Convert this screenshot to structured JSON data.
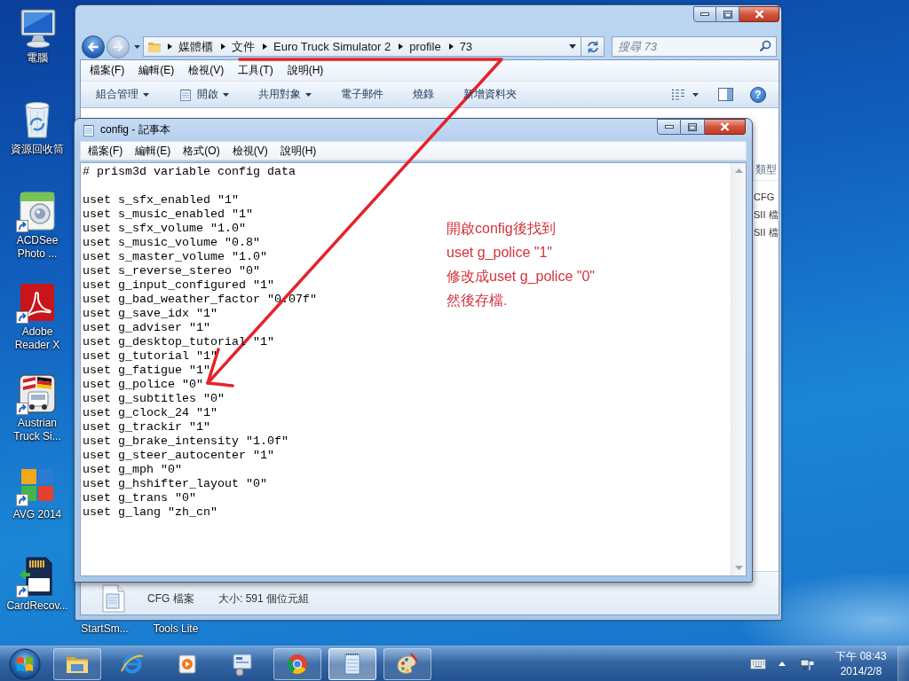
{
  "desktop_icons": [
    {
      "label": "電腦",
      "kind": "computer",
      "shortcut": false
    },
    {
      "label": "資源回收筒",
      "kind": "trash",
      "shortcut": false
    },
    {
      "label": "ACDSee Photo ...",
      "kind": "camera",
      "shortcut": true
    },
    {
      "label": "Adobe Reader X",
      "kind": "pdf",
      "shortcut": true
    },
    {
      "label": "Austrian Truck Si...",
      "kind": "truck",
      "shortcut": true
    },
    {
      "label": "AVG 2014",
      "kind": "grid",
      "shortcut": true
    },
    {
      "label": "CardRecov...",
      "kind": "card",
      "shortcut": true
    }
  ],
  "covered_desktop_labels": [
    "StartSm...",
    "Tools Lite"
  ],
  "explorer": {
    "history": [
      {
        "kind": "back",
        "disabled": false
      },
      {
        "kind": "forward",
        "disabled": true
      }
    ],
    "crumbs": [
      "媒體櫃",
      "文件",
      "Euro Truck Simulator 2",
      "profile",
      "73"
    ],
    "search": {
      "placeholder": "搜尋 73"
    },
    "menu": [
      "檔案(F)",
      "編輯(E)",
      "檢視(V)",
      "工具(T)",
      "說明(H)"
    ],
    "toolbar": [
      {
        "label": "組合管理",
        "dropdown": true,
        "icon": false
      },
      {
        "label": "開啟",
        "dropdown": true,
        "icon": true
      },
      {
        "label": "共用對象",
        "dropdown": true,
        "icon": false
      },
      {
        "label": "電子郵件",
        "dropdown": false,
        "icon": false
      },
      {
        "label": "燒錄",
        "dropdown": false,
        "icon": false
      },
      {
        "label": "新增資料夾",
        "dropdown": false,
        "icon": false
      }
    ],
    "help_button": "?",
    "file_list": {
      "column_heading": "類型",
      "rows": [
        "CFG",
        "SII 檔",
        "SII 檔"
      ]
    },
    "details": {
      "type": "CFG 檔案",
      "size": "大小: 591 個位元組"
    }
  },
  "notepad": {
    "title": "config - 記事本",
    "menu": [
      "檔案(F)",
      "編輯(E)",
      "格式(O)",
      "檢視(V)",
      "說明(H)"
    ],
    "header_line": "# prism3d variable config data",
    "lines": [
      "uset s_sfx_enabled \"1\"",
      "uset s_music_enabled \"1\"",
      "uset s_sfx_volume \"1.0\"",
      "uset s_music_volume \"0.8\"",
      "uset s_master_volume \"1.0\"",
      "uset s_reverse_stereo \"0\"",
      "uset g_input_configured \"1\"",
      "uset g_bad_weather_factor \"0.07f\"",
      "uset g_save_idx \"1\"",
      "uset g_adviser \"1\"",
      "uset g_desktop_tutorial \"1\"",
      "uset g_tutorial \"1\"",
      "uset g_fatigue \"1\"",
      "uset g_police \"0\"",
      "uset g_subtitles \"0\"",
      "uset g_clock_24 \"1\"",
      "uset g_trackir \"1\"",
      "uset g_brake_intensity \"1.0f\"",
      "uset g_steer_autocenter \"1\"",
      "uset g_mph \"0\"",
      "uset g_hshifter_layout \"0\"",
      "uset g_trans \"0\"",
      "uset g_lang \"zh_cn\""
    ]
  },
  "annotation": {
    "lines": [
      "開啟config後找到",
      "uset g_police \"1\"",
      "修改成uset g_police \"0\"",
      "然後存檔."
    ]
  },
  "taskbar": {
    "items": [
      {
        "kind": "folder",
        "running": true,
        "selected": false
      },
      {
        "kind": "globe",
        "running": false,
        "selected": false
      },
      {
        "kind": "player",
        "running": false,
        "selected": false
      },
      {
        "kind": "panel",
        "running": false,
        "selected": false
      },
      {
        "kind": "ball",
        "running": true,
        "selected": false
      },
      {
        "kind": "notepad",
        "running": true,
        "selected": true
      },
      {
        "kind": "palette",
        "running": true,
        "selected": false
      }
    ],
    "clock": {
      "time": "下午 08:43",
      "date": "2014/2/8"
    }
  }
}
